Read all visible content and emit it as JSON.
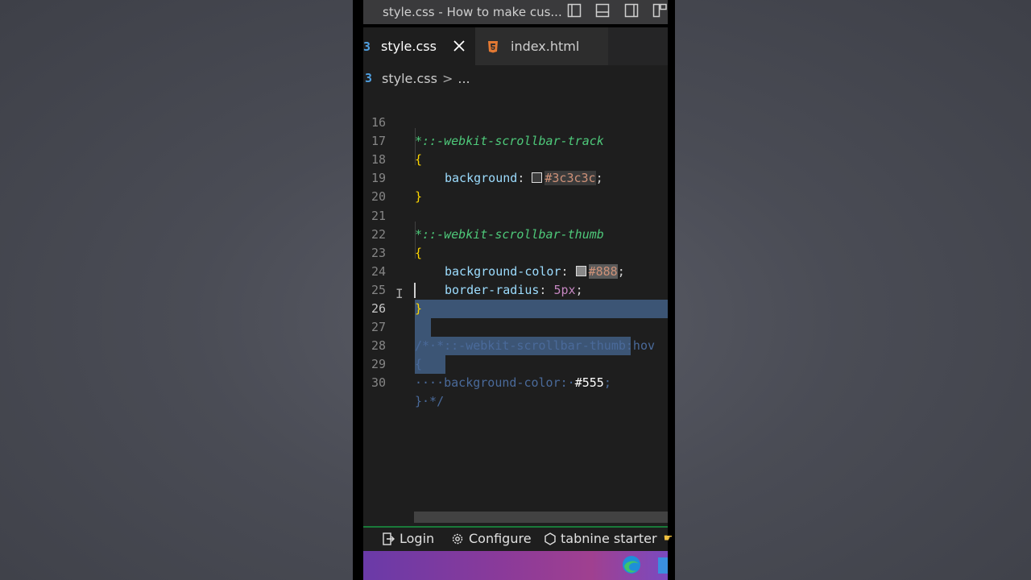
{
  "window": {
    "title": "style.css - How to make cus..."
  },
  "tabs": [
    {
      "label": "style.css",
      "icon": "css-icon",
      "active": true
    },
    {
      "label": "index.html",
      "icon": "html-icon",
      "active": false
    }
  ],
  "breadcrumb": {
    "file": "style.css",
    "separator": ">",
    "more": "..."
  },
  "code_lines": [
    {
      "num": "16",
      "text": "*::-webkit-scrollbar-track"
    },
    {
      "num": "17",
      "text": "{"
    },
    {
      "num": "18",
      "prop": "background",
      "colon": ":",
      "value": "#3c3c3c",
      "semi": ";",
      "swatch": "#3c3c3c"
    },
    {
      "num": "19",
      "text": "}"
    },
    {
      "num": "20",
      "text": ""
    },
    {
      "num": "21",
      "text": "*::-webkit-scrollbar-thumb"
    },
    {
      "num": "22",
      "text": "{"
    },
    {
      "num": "23",
      "prop": "background-color",
      "colon": ":",
      "value": "#888",
      "semi": ";",
      "swatch": "#888888"
    },
    {
      "num": "24",
      "prop": "border-radius",
      "colon": ":",
      "value": "5px",
      "semi": ";"
    },
    {
      "num": "25",
      "text": "}"
    },
    {
      "num": "26",
      "text": ""
    },
    {
      "num": "27",
      "text": "/*·*::-webkit-scrollbar-thumb:hov"
    },
    {
      "num": "28",
      "text": "{"
    },
    {
      "num": "29",
      "prefix": "····background-color:·",
      "value": "#555",
      "suffix": ";"
    },
    {
      "num": "30",
      "text": "}·*/"
    }
  ],
  "statusbar": {
    "login": "Login",
    "configure": "Configure",
    "tabnine": "tabnine starter"
  },
  "colors": {
    "selector": "#4ec97a",
    "property": "#9cdcfe",
    "value": "#ce9178",
    "number": "#c586c0",
    "bracket": "#ffd700",
    "accent": "#1a7a3a"
  }
}
